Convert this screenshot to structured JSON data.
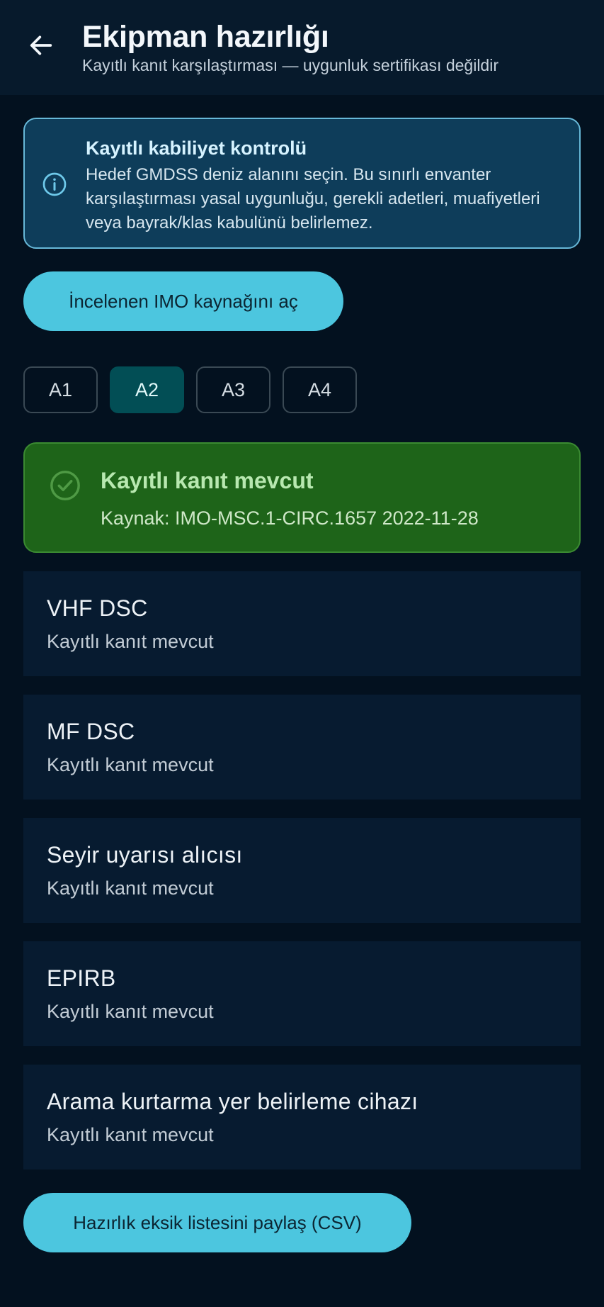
{
  "header": {
    "title": "Ekipman hazırlığı",
    "subtitle": "Kayıtlı kanıt karşılaştırması — uygunluk sertifikası değildir"
  },
  "info": {
    "title": "Kayıtlı kabiliyet kontrolü",
    "body": "Hedef GMDSS deniz alanını seçin. Bu sınırlı envanter karşılaştırması yasal uygunluğu, gerekli adetleri, muafiyetleri veya bayrak/klas kabulünü belirlemez."
  },
  "source_button_label": "İncelenen IMO kaynağını aç",
  "tabs": [
    {
      "label": "A1",
      "active": false
    },
    {
      "label": "A2",
      "active": true
    },
    {
      "label": "A3",
      "active": false
    },
    {
      "label": "A4",
      "active": false
    }
  ],
  "status": {
    "title": "Kayıtlı kanıt mevcut",
    "source": "Kaynak: IMO-MSC.1-CIRC.1657 2022-11-28"
  },
  "items": [
    {
      "name": "VHF DSC",
      "status": "Kayıtlı kanıt mevcut"
    },
    {
      "name": "MF DSC",
      "status": "Kayıtlı kanıt mevcut"
    },
    {
      "name": "Seyir uyarısı alıcısı",
      "status": "Kayıtlı kanıt mevcut"
    },
    {
      "name": "EPIRB",
      "status": "Kayıtlı kanıt mevcut"
    },
    {
      "name": "Arama kurtarma yer belirleme cihazı",
      "status": "Kayıtlı kanıt mevcut"
    }
  ],
  "share_button_label": "Hazırlık eksik listesini paylaş (CSV)",
  "colors": {
    "background": "#03111f",
    "accent": "#4cc6df",
    "success": "#1e6419",
    "info": "#0e3d5a"
  }
}
